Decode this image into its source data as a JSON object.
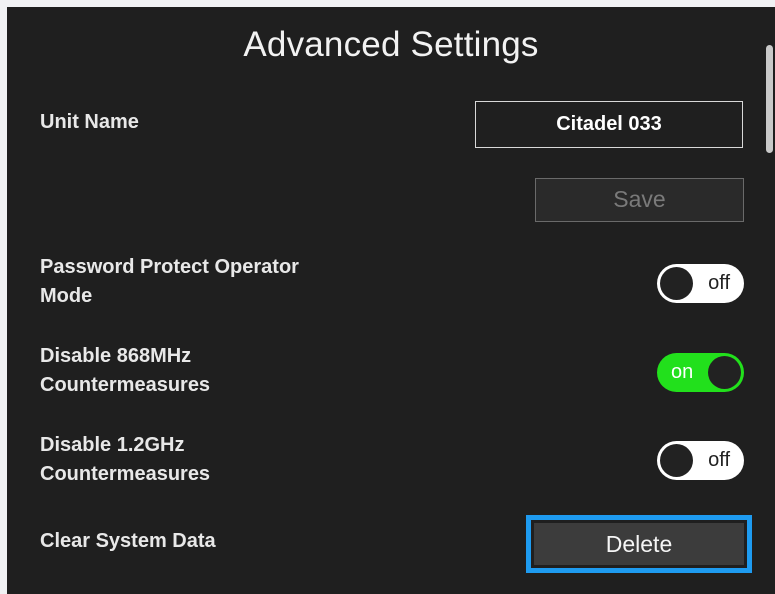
{
  "title": "Advanced Settings",
  "unit_name": {
    "label": "Unit Name",
    "value": "Citadel 033"
  },
  "save_label": "Save",
  "settings": [
    {
      "label": "Password Protect Operator Mode",
      "state": "off"
    },
    {
      "label": "Disable 868MHz Countermeasures",
      "state": "on"
    },
    {
      "label": "Disable 1.2GHz Countermeasures",
      "state": "off"
    }
  ],
  "clear_data": {
    "label": "Clear System Data",
    "button_label": "Delete"
  },
  "colors": {
    "background": "#1f1f1f",
    "toggle_on": "#22e01c",
    "highlight": "#1e9bf0"
  }
}
